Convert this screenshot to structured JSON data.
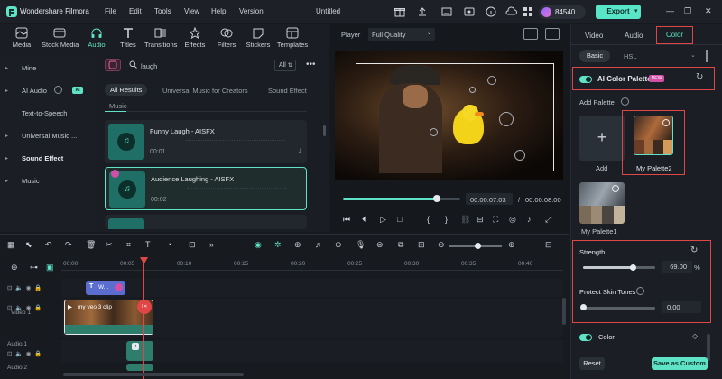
{
  "titlebar": {
    "app_title": "Wondershare Filmora",
    "menus": [
      "File",
      "Edit",
      "Tools",
      "View",
      "Help",
      "Version"
    ],
    "project_title": "Untitled",
    "credits": "84540",
    "export_label": "Export"
  },
  "library": {
    "tabs": [
      "Media",
      "Stock Media",
      "Audio",
      "Titles",
      "Transitions",
      "Effects",
      "Filters",
      "Stickers",
      "Templates"
    ],
    "sidebar": [
      "Mine",
      "AI Audio",
      "Text-to-Speech",
      "Universal Music ...",
      "Sound Effect",
      "Music"
    ],
    "ai_badge": "AI",
    "search_value": "laugh",
    "filter_label": "All",
    "subtabs": [
      "All Results",
      "Universal Music for Creators",
      "Sound Effect"
    ],
    "category": "Music",
    "items": [
      {
        "title": "Funny Laugh - AISFX",
        "duration": "00:01"
      },
      {
        "title": "Audience Laughing - AISFX",
        "duration": "00:02"
      },
      {
        "title": "",
        "duration": ""
      }
    ]
  },
  "player": {
    "label": "Player",
    "quality": "Full Quality",
    "progress": 0.8,
    "current_time": "00:00:07:03",
    "separator": "/",
    "total_time": "00:00:08:00"
  },
  "right_panel": {
    "tabs": [
      "Video",
      "Audio",
      "Color"
    ],
    "active_tab": "Color",
    "modes": [
      "Basic",
      "HSL"
    ],
    "ai_color_palette": "AI Color Palette",
    "new_badge": "NEW",
    "add_palette_label": "Add Palette",
    "add_label": "Add",
    "palettes": [
      "My Palette2",
      "My Palette1"
    ],
    "strength_label": "Strength",
    "strength_value": "69.00",
    "strength_unit": "%",
    "strength_level": 0.69,
    "protect_label": "Protect Skin Tones",
    "protect_value": "0.00",
    "protect_level": 0.0,
    "color_label": "Color",
    "reset_label": "Reset",
    "save_label": "Save as Custom"
  },
  "timeline": {
    "ruler_labels": [
      "00:00",
      "00:05",
      "00:10",
      "00:15",
      "00:20",
      "00:25",
      "00:30",
      "00:35",
      "00:40"
    ],
    "tracks": [
      "Video 1",
      "Audio 1",
      "Audio 2"
    ],
    "title_clip": "W...",
    "video_clip": "my veo 3 clip"
  },
  "colors": {
    "accent": "#5fe3c6",
    "highlight": "#e14646",
    "panel": "#1b1f25"
  }
}
